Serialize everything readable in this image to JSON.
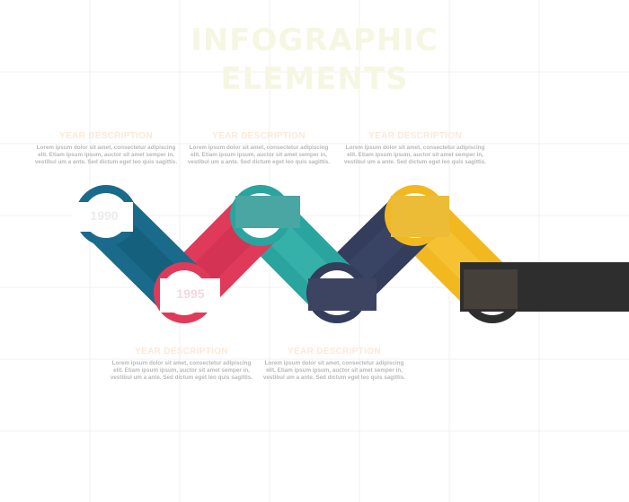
{
  "title": {
    "line1": "INFOGRAPHIC",
    "line2": "ELEMENTS"
  },
  "top_labels": [
    {
      "heading": "YEAR DESCRIPTION",
      "body": "Lorem ipsum dolor sit amet, consectetur adipiscing elit. Etiam ipsum ipsum, auctor sit amet semper in, vestibul um a ante. Sed dictum eget leo quis sagittis."
    },
    {
      "heading": "YEAR DESCRIPTION",
      "body": "Lorem ipsum dolor sit amet, consectetur adipiscing elit. Etiam ipsum ipsum, auctor sit amet semper in, vestibul um a ante. Sed dictum eget leo quis sagittis."
    },
    {
      "heading": "YEAR DESCRIPTION",
      "body": "Lorem ipsum dolor sit amet, consectetur adipiscing elit. Etiam ipsum ipsum, auctor sit amet semper in, vestibul um a ante. Sed dictum eget leo quis sagittis."
    }
  ],
  "bottom_labels": [
    {
      "heading": "YEAR DESCRIPTION",
      "body": "Lorem ipsum dolor sit amet, consectetur adipiscing elit. Etiam ipsum ipsum, auctor sit amet semper in, vestibul um a ante. Sed dictum eget leo quis sagittis."
    },
    {
      "heading": "YEAR DESCRIPTION",
      "body": "Lorem ipsum dolor sit amet, consectetur adipiscing elit. Etiam ipsum ipsum, auctor sit amet semper in, vestibul um a ante. Sed dictum eget leo quis sagittis."
    }
  ],
  "years": {
    "first": "1990",
    "second": "1995"
  },
  "colors": {
    "teal_dark": "#1a6b8b",
    "crimson": "#e03a5a",
    "teal": "#2aa49e",
    "navy": "#343d5c",
    "yellow": "#f2b820",
    "dark": "#2e2e2e"
  }
}
